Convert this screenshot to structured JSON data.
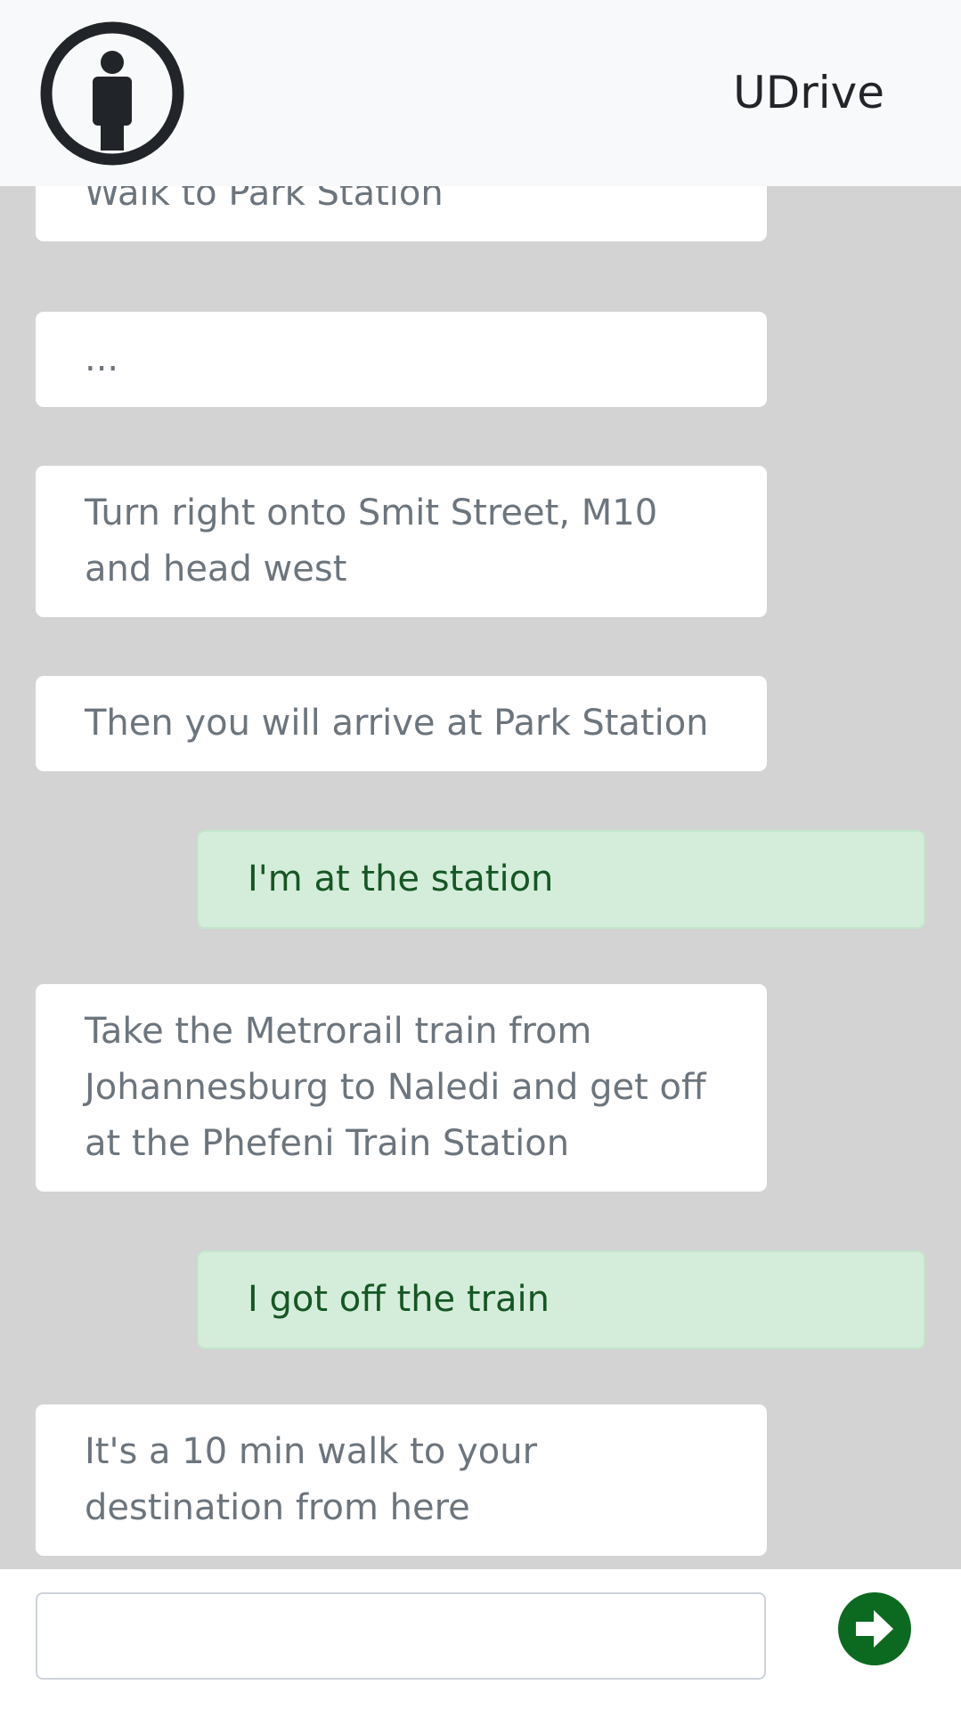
{
  "header": {
    "brand": "UDrive",
    "logo_icon": "info-person-icon"
  },
  "messages": [
    {
      "sender": "bot",
      "text": "Walk to Park Station"
    },
    {
      "sender": "bot",
      "text": "..."
    },
    {
      "sender": "bot",
      "text": "Turn right onto Smit Street, M10 and head west"
    },
    {
      "sender": "bot",
      "text": "Then you will arrive at Park Station"
    },
    {
      "sender": "user",
      "text": "I'm at the station"
    },
    {
      "sender": "bot",
      "text": "Take the Metrorail train from Johannesburg to Naledi and get off at the Phefeni Train Station"
    },
    {
      "sender": "user",
      "text": "I got off the train"
    },
    {
      "sender": "bot",
      "text": "It's a 10 min walk to your destination from here"
    }
  ],
  "composer": {
    "value": "",
    "placeholder": "",
    "send_icon": "arrow-right-circle-icon"
  },
  "colors": {
    "background": "#d3d3d3",
    "header": "#f8f9fa",
    "bot_bubble": "#ffffff",
    "user_bubble": "#d4edda",
    "user_text": "#155724",
    "send_button": "#0b6a1f"
  }
}
